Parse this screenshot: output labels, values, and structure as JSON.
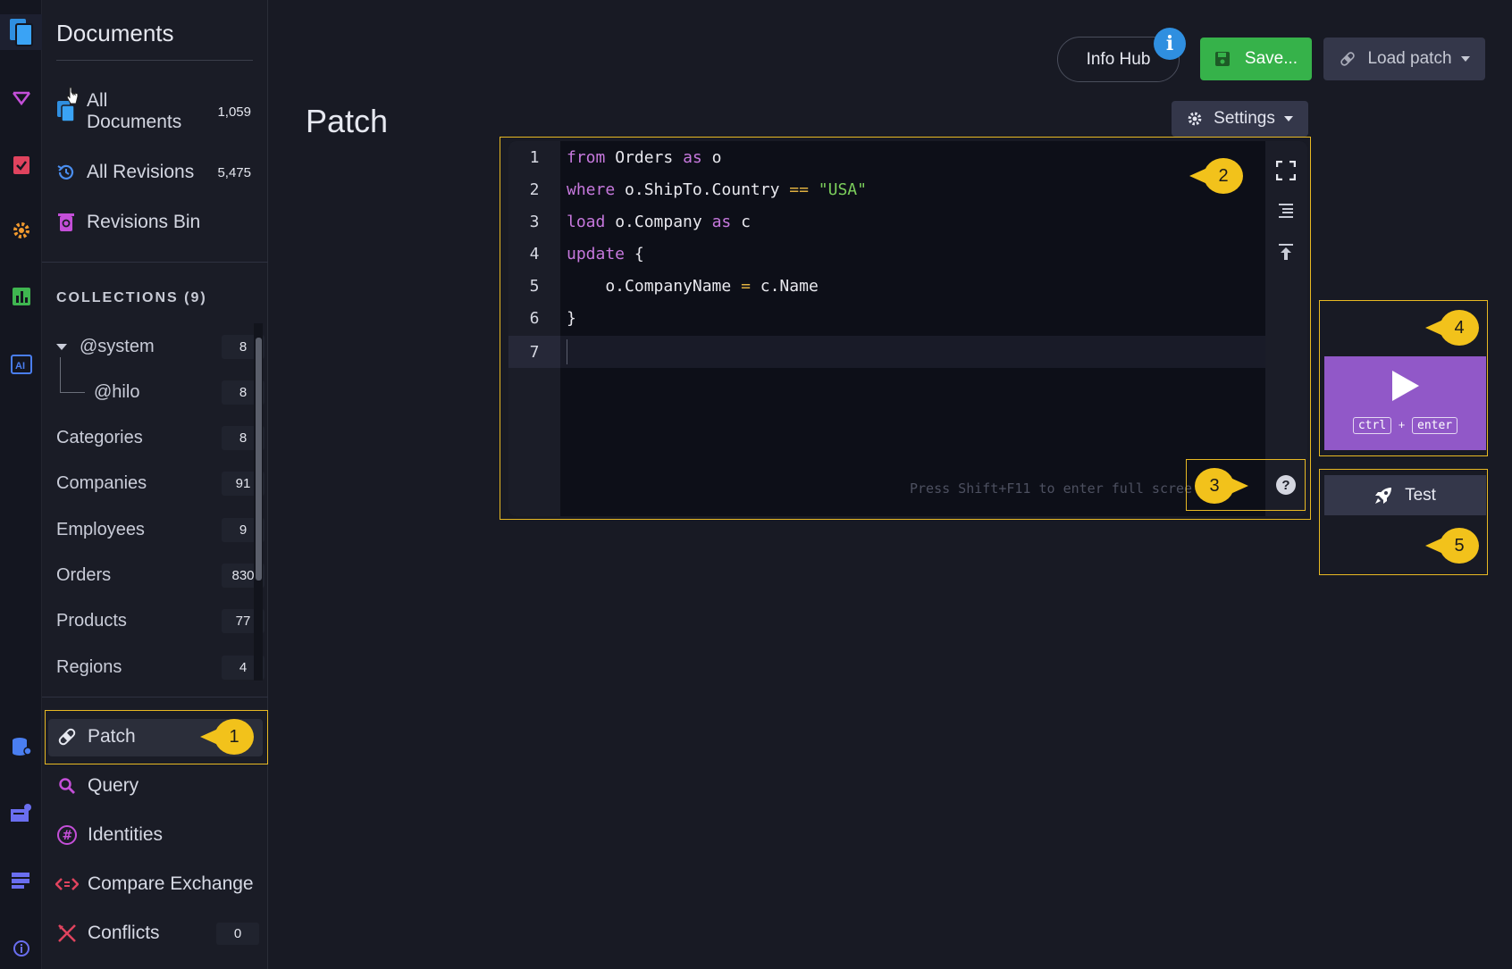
{
  "rail": {
    "items": [
      "documents-icon",
      "graph-icon",
      "tasks-icon",
      "settings-icon",
      "stats-icon",
      "ai-icon",
      "databases-icon",
      "cluster-icon",
      "server-icon",
      "about-icon"
    ]
  },
  "sidebar": {
    "title": "Documents",
    "top_items": [
      {
        "label_1": "All",
        "label_2": "Documents",
        "count": "1,059"
      },
      {
        "label": "All Revisions",
        "count": "5,475"
      },
      {
        "label": "Revisions Bin"
      }
    ],
    "collections_heading": "COLLECTIONS (9)",
    "collections": [
      {
        "name": "@system",
        "count": "8"
      },
      {
        "name": "@hilo",
        "count": "8"
      },
      {
        "name": "Categories",
        "count": "8"
      },
      {
        "name": "Companies",
        "count": "91"
      },
      {
        "name": "Employees",
        "count": "9"
      },
      {
        "name": "Orders",
        "count": "830"
      },
      {
        "name": "Products",
        "count": "77"
      },
      {
        "name": "Regions",
        "count": "4"
      }
    ],
    "nav": [
      {
        "label": "Patch"
      },
      {
        "label": "Query"
      },
      {
        "label": "Identities"
      },
      {
        "label": "Compare Exchange"
      },
      {
        "label": "Conflicts",
        "count": "0"
      }
    ]
  },
  "header": {
    "info_hub": "Info Hub",
    "info_badge": "i",
    "save": "Save...",
    "load_patch": "Load patch",
    "settings": "Settings"
  },
  "main": {
    "title": "Patch"
  },
  "editor": {
    "line_numbers": [
      "1",
      "2",
      "3",
      "4",
      "5",
      "6",
      "7"
    ],
    "lines": {
      "l1": {
        "kw1": "from",
        "t1": " Orders ",
        "kw2": "as",
        "t2": " o"
      },
      "l2": {
        "kw1": "where",
        "t1": " o.ShipTo.Country ",
        "op": "==",
        "str": " \"USA\""
      },
      "l3": {
        "kw1": "load",
        "t1": " o.Company ",
        "kw2": "as",
        "t2": " c"
      },
      "l4": {
        "kw1": "update",
        "t1": " {"
      },
      "l5": {
        "t1": "    o.CompanyName ",
        "op": "=",
        "t2": " c.Name"
      },
      "l6": {
        "t1": "}"
      }
    },
    "hint": "Press Shift+F11 to enter full scree"
  },
  "run": {
    "ctrl": "ctrl",
    "plus": "+",
    "enter": "enter"
  },
  "test": {
    "label": "Test"
  },
  "callouts": [
    "1",
    "2",
    "3",
    "4",
    "5"
  ],
  "colors": {
    "accent_yellow": "#f2c21b",
    "save_green": "#36b24a",
    "run_purple": "#9158c8",
    "info_blue": "#2f8fe0"
  }
}
